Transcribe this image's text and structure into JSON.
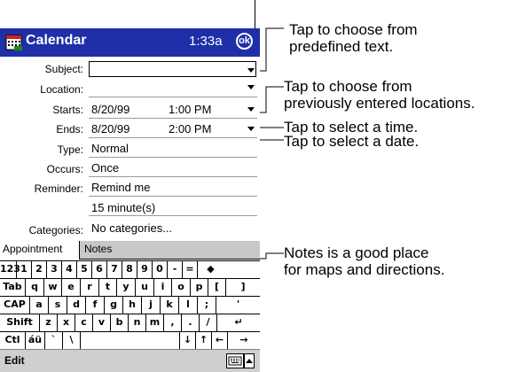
{
  "titlebar": {
    "app_title": "Calendar",
    "time": "1:33a",
    "ok_label": "ok"
  },
  "form": {
    "subject_label": "Subject:",
    "location_label": "Location:",
    "starts_label": "Starts:",
    "starts_date": "8/20/99",
    "starts_time": "1:00 PM",
    "ends_label": "Ends:",
    "ends_date": "8/20/99",
    "ends_time": "2:00 PM",
    "type_label": "Type:",
    "type_value": "Normal",
    "occurs_label": "Occurs:",
    "occurs_value": "Once",
    "reminder_label": "Reminder:",
    "reminder_value": "Remind me",
    "reminder_amount": "15  minute(s)",
    "categories_label": "Categories:",
    "categories_value": "No categories..."
  },
  "tabs": {
    "appointment": "Appointment",
    "notes": "Notes"
  },
  "keyboard": {
    "row1": [
      "123",
      "1",
      "2",
      "3",
      "4",
      "5",
      "6",
      "7",
      "8",
      "9",
      "0",
      "-",
      "=",
      "◆"
    ],
    "row2": [
      "Tab",
      "q",
      "w",
      "e",
      "r",
      "t",
      "y",
      "u",
      "i",
      "o",
      "p",
      "[",
      "]"
    ],
    "row3": [
      "CAP",
      "a",
      "s",
      "d",
      "f",
      "g",
      "h",
      "j",
      "k",
      "l",
      ";",
      "'"
    ],
    "row4": [
      "Shift",
      "z",
      "x",
      "c",
      "v",
      "b",
      "n",
      "m",
      ",",
      ".",
      "/",
      "↵"
    ],
    "row5": [
      "Ctl",
      "áü",
      "`",
      "\\",
      "",
      "↓",
      "↑",
      "←",
      "→"
    ]
  },
  "menubar": {
    "edit_label": "Edit"
  },
  "annotations": {
    "predefined_1": "Tap to choose from",
    "predefined_2": "predefined text.",
    "locations_1": "Tap to choose from",
    "locations_2": "previously entered locations.",
    "time": "Tap to select a time.",
    "date": "Tap to select a date.",
    "notes_1": "Notes is a good place",
    "notes_2": "for maps and directions."
  },
  "colors": {
    "titlebar": "#1f2fa8",
    "notes_tab": "#c8c8c8",
    "menubar": "#cfcfcf"
  }
}
